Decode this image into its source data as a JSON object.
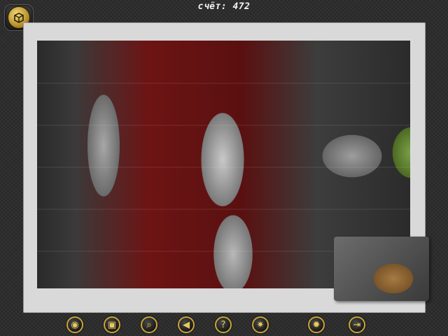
{
  "hud": {
    "score_text": "счёт: 472"
  },
  "icons": {
    "menu": "menu-box-icon",
    "toolbar": [
      {
        "name": "eye-icon",
        "glyph": "◉"
      },
      {
        "name": "preview-image-icon",
        "glyph": "▣"
      },
      {
        "name": "magnifier-icon",
        "glyph": "⌕"
      },
      {
        "name": "arrow-left-icon",
        "glyph": "◀"
      },
      {
        "name": "question-icon",
        "glyph": "?"
      },
      {
        "name": "scatter-pieces-icon",
        "glyph": "✷"
      },
      {
        "name": "settings-gear-icon",
        "glyph": "✹"
      },
      {
        "name": "exit-door-icon",
        "glyph": "⇥"
      }
    ]
  },
  "colors": {
    "accent_gold": "#c9a53a",
    "board": "#d9d9d9",
    "background": "#2a2a2a"
  }
}
